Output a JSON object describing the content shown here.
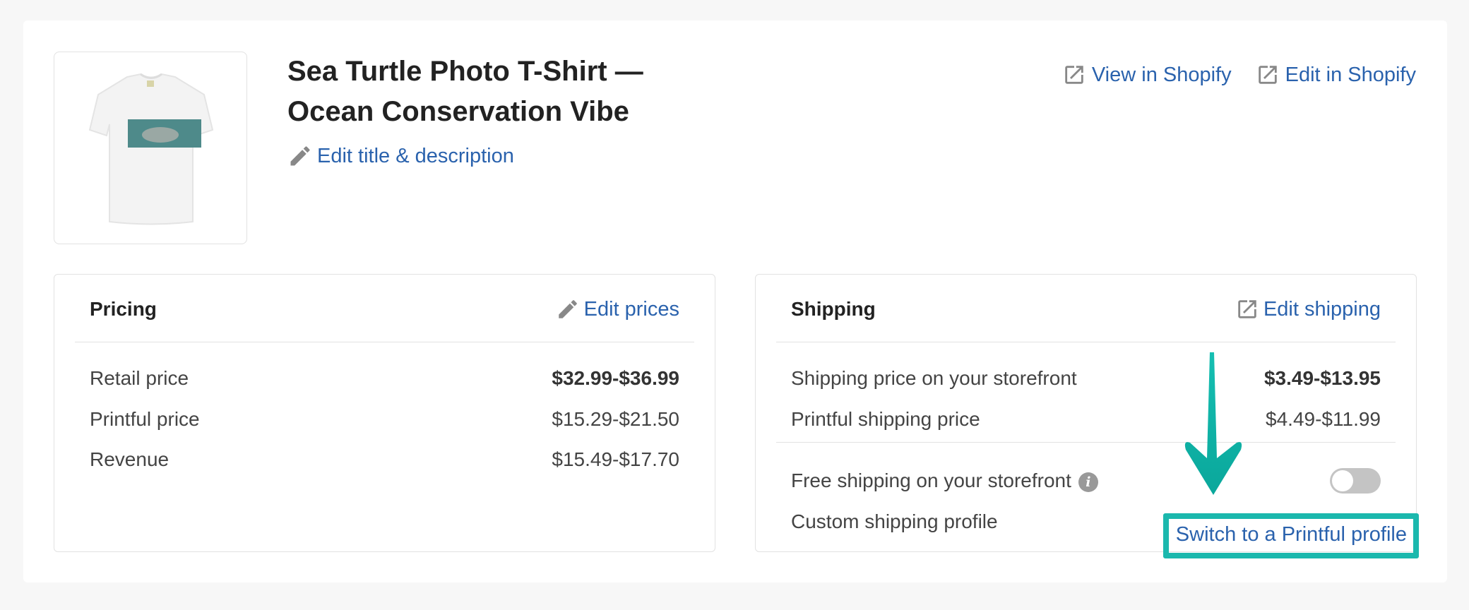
{
  "product": {
    "title": "Sea Turtle Photo T-Shirt — Ocean Conservation Vibe",
    "edit_title_label": "Edit title & description",
    "thumbnail_icon": "tshirt-image"
  },
  "header_links": {
    "view": "View in Shopify",
    "edit": "Edit in Shopify"
  },
  "pricing": {
    "title": "Pricing",
    "edit_label": "Edit prices",
    "rows": [
      {
        "label": "Retail price",
        "value": "$32.99-$36.99"
      },
      {
        "label": "Printful price",
        "value": "$15.29-$21.50"
      },
      {
        "label": "Revenue",
        "value": "$15.49-$17.70"
      }
    ]
  },
  "shipping": {
    "title": "Shipping",
    "edit_label": "Edit shipping",
    "rows": [
      {
        "label": "Shipping price on your storefront",
        "value": "$3.49-$13.95"
      },
      {
        "label": "Printful shipping price",
        "value": "$4.49-$11.99"
      }
    ],
    "free_shipping_label": "Free shipping on your storefront",
    "free_shipping_enabled": false,
    "custom_profile_label": "Custom shipping profile",
    "switch_label": "Switch to a Printful profile"
  },
  "colors": {
    "link": "#2a62ad",
    "highlight": "#1bb8ad"
  }
}
